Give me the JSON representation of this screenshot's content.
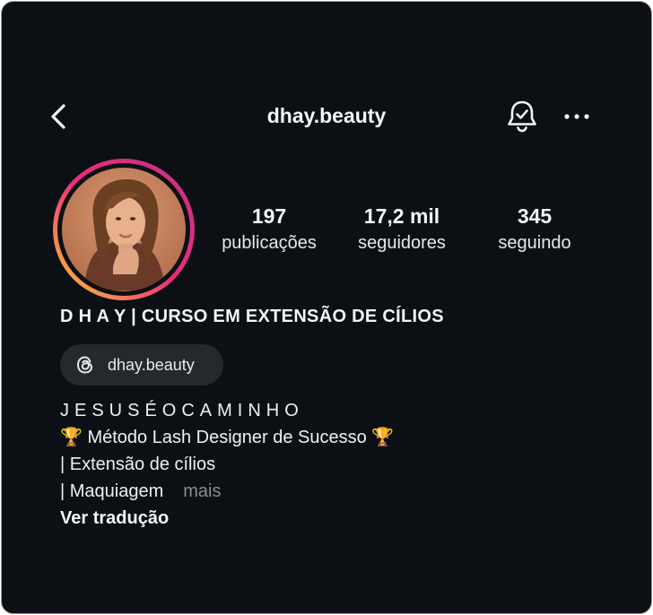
{
  "header": {
    "title": "dhay.beauty",
    "back_icon": "chevron-left-icon",
    "bell_icon": "bell-check-icon",
    "more_icon": "more-horizontal-icon"
  },
  "profile": {
    "avatar_icon": "profile-photo",
    "story_ring_colors": [
      "#f9ce34",
      "#ee2a7b",
      "#c13584"
    ],
    "stats": [
      {
        "value": "197",
        "label": "publicações"
      },
      {
        "value": "17,2 mil",
        "label": "seguidores"
      },
      {
        "value": "345",
        "label": "seguindo"
      }
    ],
    "display_name": "D H A Y | CURSO EM EXTENSÃO DE CÍLIOS",
    "threads_chip": {
      "icon": "threads-icon",
      "label": "dhay.beauty"
    },
    "bio": {
      "line1": "JESUSÉOCAMINHO",
      "line2": "🏆 Método Lash Designer de Sucesso 🏆",
      "line3": "| Extensão de cílios",
      "line4": "| Maquiagem",
      "more": "mais",
      "translate": "Ver tradução"
    }
  },
  "colors": {
    "background": "#0c1014",
    "text": "#f5f5f5",
    "muted": "#8a8d91",
    "chip": "#25292e"
  }
}
